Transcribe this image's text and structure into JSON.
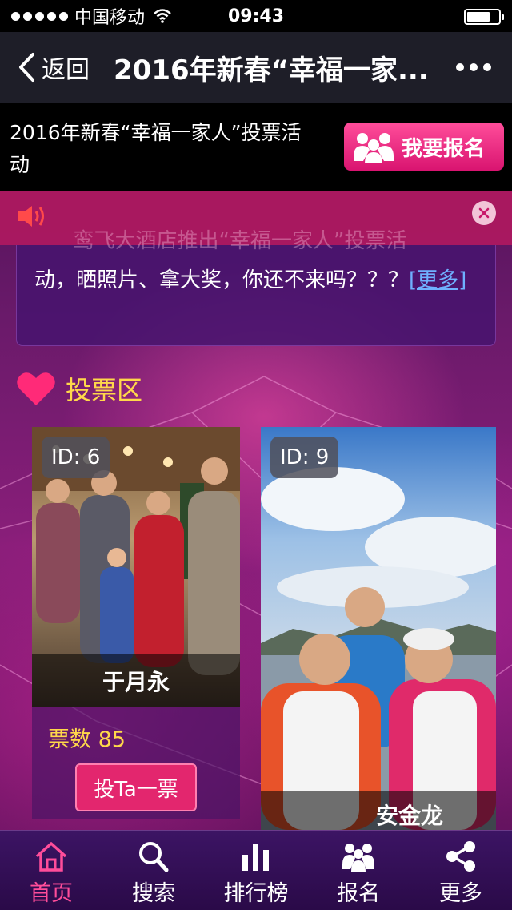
{
  "status_bar": {
    "carrier": "中国移动",
    "time": "09:43"
  },
  "nav": {
    "back_label": "返回",
    "title": "2016年新春“幸福一家..."
  },
  "header": {
    "title": "2016年新春“幸福一家人”投票活动",
    "signup_button": "我要报名"
  },
  "notice": {
    "text_faded": "鸾飞大酒店推出“幸福一家人”投票活"
  },
  "intro": {
    "text": "动，晒照片、拿大奖，你还不来吗？？？",
    "more_link": "[更多]"
  },
  "section": {
    "title": "投票区"
  },
  "cards": [
    {
      "id_label": "ID: 6",
      "name": "于月永",
      "votes_label": "票数",
      "votes": "85",
      "vote_button": "投Ta一票"
    },
    {
      "id_label": "ID: 9",
      "name": "安金龙"
    }
  ],
  "tabs": [
    {
      "label": "首页",
      "icon": "home-icon",
      "active": true
    },
    {
      "label": "搜索",
      "icon": "search-icon"
    },
    {
      "label": "排行榜",
      "icon": "bar-chart-icon"
    },
    {
      "label": "报名",
      "icon": "people-icon"
    },
    {
      "label": "更多",
      "icon": "share-icon"
    }
  ],
  "colors": {
    "accent": "#e3266e",
    "gold": "#ffd84a",
    "link": "#6fb0ff",
    "tab_active": "#ff4d9a"
  }
}
